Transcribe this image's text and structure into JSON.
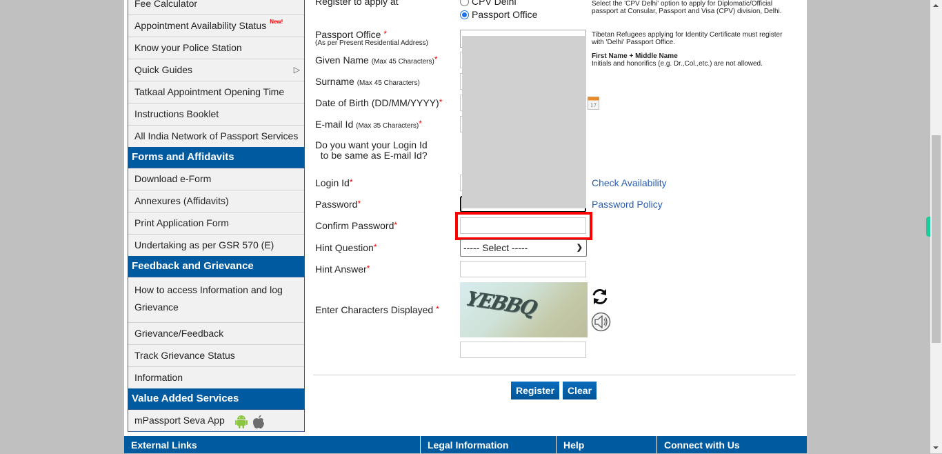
{
  "sidebar": {
    "items_top": [
      {
        "label": "Fee Calculator"
      },
      {
        "label": "Appointment Availability Status",
        "badge": "New!"
      },
      {
        "label": "Know your Police Station"
      },
      {
        "label": "Quick Guides",
        "has_submenu": true
      },
      {
        "label": "Tatkaal Appointment Opening Time"
      },
      {
        "label": "Instructions Booklet"
      },
      {
        "label": "All India Network of Passport Services"
      }
    ],
    "forms_heading": "Forms and Affidavits",
    "forms_items": [
      {
        "label": "Download e-Form"
      },
      {
        "label": "Annexures (Affidavits)"
      },
      {
        "label": "Print Application Form"
      },
      {
        "label": "Undertaking as per GSR 570 (E)"
      }
    ],
    "feedback_heading": "Feedback and Grievance",
    "feedback_items": [
      {
        "label": "How to access Information and log Grievance"
      },
      {
        "label": "Grievance/Feedback"
      },
      {
        "label": "Track Grievance Status"
      },
      {
        "label": "Information"
      }
    ],
    "vas_heading": "Value Added Services",
    "vas_items": [
      {
        "label": "mPassport Seva App",
        "icons": [
          "android-icon",
          "apple-icon"
        ]
      }
    ]
  },
  "form": {
    "register_at_label": "Register to apply at",
    "register_options": [
      {
        "label": "CPV Delhi",
        "selected": false
      },
      {
        "label": "Passport Office",
        "selected": true
      }
    ],
    "register_help": "Select the 'CPV Delhi' option to apply for Diplomatic/Official passport at Consular, Passport and Visa (CPV) division, Delhi.",
    "passport_office_label": "Passport Office",
    "passport_office_sub": "(As per Present Residential Address)",
    "passport_office_help": "Tibetan Refugees applying for Identity Certificate must register with 'Delhi' Passport Office.",
    "given_name_label": "Given Name",
    "given_name_note": "(Max 45 Characters)",
    "given_name_help_title": "First Name + Middle Name",
    "given_name_help": "Initials and honorifics (e.g. Dr.,Col.,etc.) are not allowed.",
    "surname_label": "Surname",
    "surname_note": "(Max 45 Characters)",
    "dob_label": "Date of Birth (DD/MM/YYYY)",
    "email_label": "E-mail Id",
    "email_note": "(Max 35 Characters)",
    "same_login_label_1": "Do you want your Login Id",
    "same_login_label_2": "to be same as E-mail Id?",
    "login_id_label": "Login Id",
    "check_availability": "Check Availability",
    "password_label": "Password",
    "password_policy": "Password Policy",
    "confirm_password_label": "Confirm Password",
    "confirm_password_value": "",
    "hint_question_label": "Hint Question",
    "hint_question_selected": "----- Select -----",
    "hint_answer_label": "Hint Answer",
    "hint_answer_value": "",
    "captcha_label": "Enter Characters Displayed",
    "captcha_text": "YEBBQ",
    "captcha_value": "",
    "required_mark": "*",
    "register_button": "Register",
    "clear_button": "Clear"
  },
  "footer": {
    "columns": [
      "External Links",
      "Legal Information",
      "Help",
      "Connect with Us"
    ]
  }
}
